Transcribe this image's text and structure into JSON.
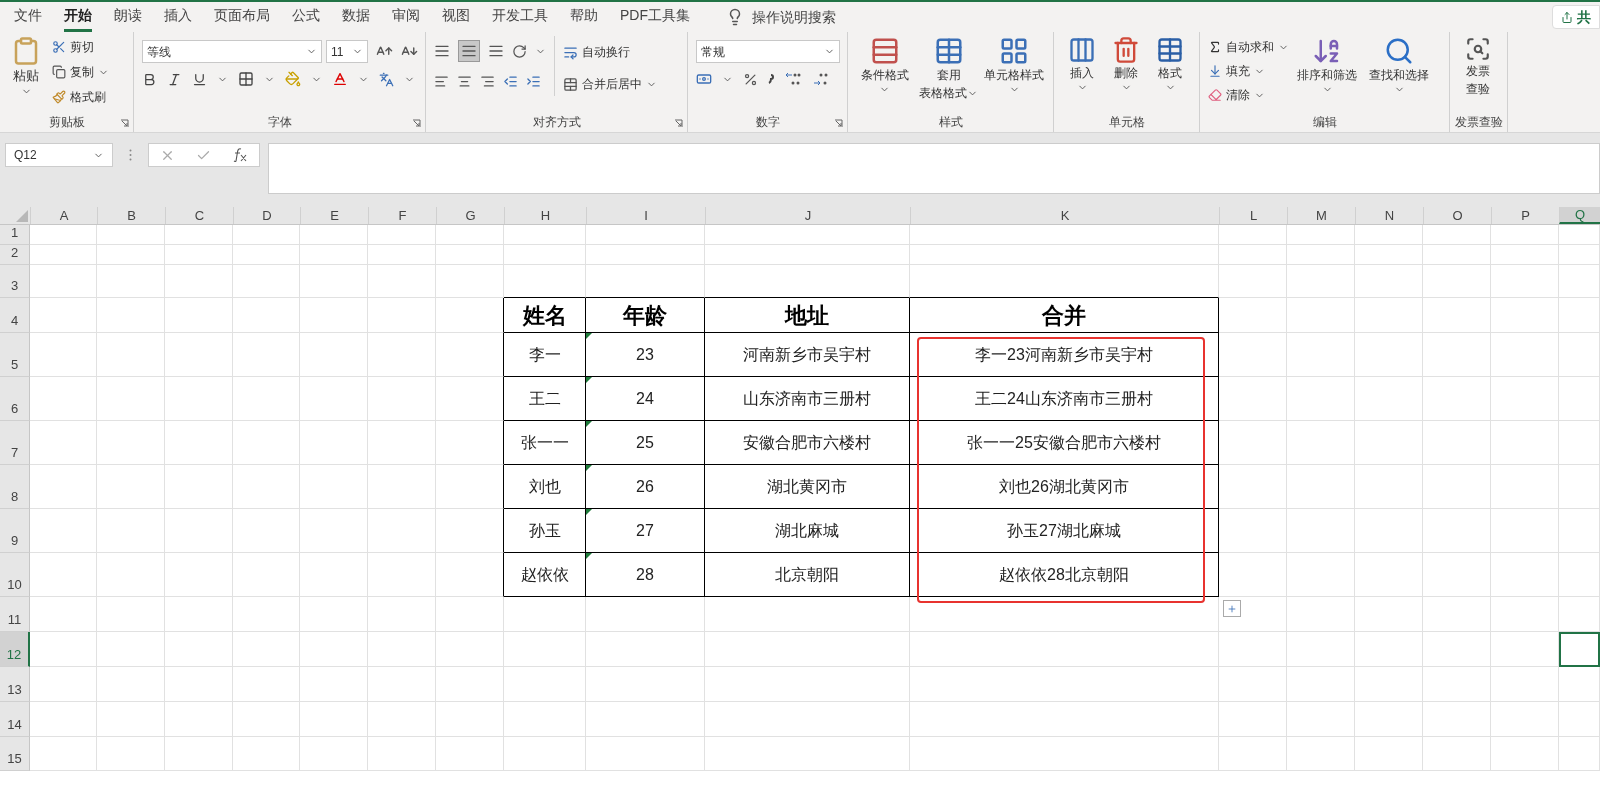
{
  "tabs": [
    {
      "label": "文件",
      "selected": false
    },
    {
      "label": "开始",
      "selected": true
    },
    {
      "label": "朗读",
      "selected": false
    },
    {
      "label": "插入",
      "selected": false
    },
    {
      "label": "页面布局",
      "selected": false
    },
    {
      "label": "公式",
      "selected": false
    },
    {
      "label": "数据",
      "selected": false
    },
    {
      "label": "审阅",
      "selected": false
    },
    {
      "label": "视图",
      "selected": false
    },
    {
      "label": "开发工具",
      "selected": false
    },
    {
      "label": "帮助",
      "selected": false
    },
    {
      "label": "PDF工具集",
      "selected": false
    }
  ],
  "tell_me": {
    "placeholder": "操作说明搜索"
  },
  "share_button": "共",
  "ribbon": {
    "clipboard": {
      "label": "剪贴板",
      "paste": "粘贴",
      "cut": "剪切",
      "copy": "复制",
      "format_painter": "格式刷"
    },
    "font": {
      "label": "字体",
      "font_name": "等线",
      "font_size": "11"
    },
    "alignment": {
      "label": "对齐方式",
      "wrap_text": "自动换行",
      "merge_center": "合并后居中"
    },
    "number": {
      "label": "数字",
      "format": "常规"
    },
    "styles": {
      "label": "样式",
      "conditional": "条件格式",
      "table_format": [
        "套用",
        "表格格式"
      ],
      "cell_styles": "单元格样式"
    },
    "cells": {
      "label": "单元格",
      "insert": "插入",
      "delete": "删除",
      "format": "格式"
    },
    "editing": {
      "label": "编辑",
      "autosum": "自动求和",
      "fill": "填充",
      "clear": "清除",
      "sort_filter": "排序和筛选",
      "find_select": "查找和选择"
    },
    "invoice": {
      "label": "发票查验",
      "button": [
        "发票",
        "查验"
      ]
    }
  },
  "formula_bar": {
    "name_box": "Q12"
  },
  "sheet": {
    "columns": [
      {
        "label": "A",
        "selected": false
      },
      {
        "label": "B",
        "selected": false
      },
      {
        "label": "C",
        "selected": false
      },
      {
        "label": "D",
        "selected": false
      },
      {
        "label": "E",
        "selected": false
      },
      {
        "label": "F",
        "selected": false
      },
      {
        "label": "G",
        "selected": false
      },
      {
        "label": "H",
        "selected": false
      },
      {
        "label": "I",
        "selected": false
      },
      {
        "label": "J",
        "selected": false
      },
      {
        "label": "K",
        "selected": false
      },
      {
        "label": "L",
        "selected": false
      },
      {
        "label": "M",
        "selected": false
      },
      {
        "label": "N",
        "selected": false
      },
      {
        "label": "O",
        "selected": false
      },
      {
        "label": "P",
        "selected": false
      },
      {
        "label": "Q",
        "selected": true
      }
    ],
    "rows": [
      {
        "label": "1",
        "selected": false
      },
      {
        "label": "2",
        "selected": false
      },
      {
        "label": "3",
        "selected": false
      },
      {
        "label": "4",
        "selected": false
      },
      {
        "label": "5",
        "selected": false
      },
      {
        "label": "6",
        "selected": false
      },
      {
        "label": "7",
        "selected": false
      },
      {
        "label": "8",
        "selected": false
      },
      {
        "label": "9",
        "selected": false
      },
      {
        "label": "10",
        "selected": false
      },
      {
        "label": "11",
        "selected": false
      },
      {
        "label": "12",
        "selected": true
      },
      {
        "label": "13",
        "selected": false
      },
      {
        "label": "14",
        "selected": false
      },
      {
        "label": "15",
        "selected": false
      }
    ],
    "table": {
      "merged_highlighted": true,
      "header": [
        "姓名",
        "年龄",
        "地址",
        "合并"
      ],
      "rows": [
        {
          "cells": [
            "李一",
            "23",
            "河南新乡市吴宇村",
            "李一23河南新乡市吴宇村"
          ],
          "flagged": true
        },
        {
          "cells": [
            "王二",
            "24",
            "山东济南市三册村",
            "王二24山东济南市三册村"
          ],
          "flagged": true
        },
        {
          "cells": [
            "张一一",
            "25",
            "安徽合肥市六楼村",
            "张一一25安徽合肥市六楼村"
          ],
          "flagged": true
        },
        {
          "cells": [
            "刘也",
            "26",
            "湖北黄冈市",
            "刘也26湖北黄冈市"
          ],
          "flagged": true
        },
        {
          "cells": [
            "孙玉",
            "27",
            "湖北麻城",
            "孙玉27湖北麻城"
          ],
          "flagged": true
        },
        {
          "cells": [
            "赵依依",
            "28",
            "北京朝阳",
            "赵依依28北京朝阳"
          ],
          "flagged": true
        }
      ]
    }
  }
}
